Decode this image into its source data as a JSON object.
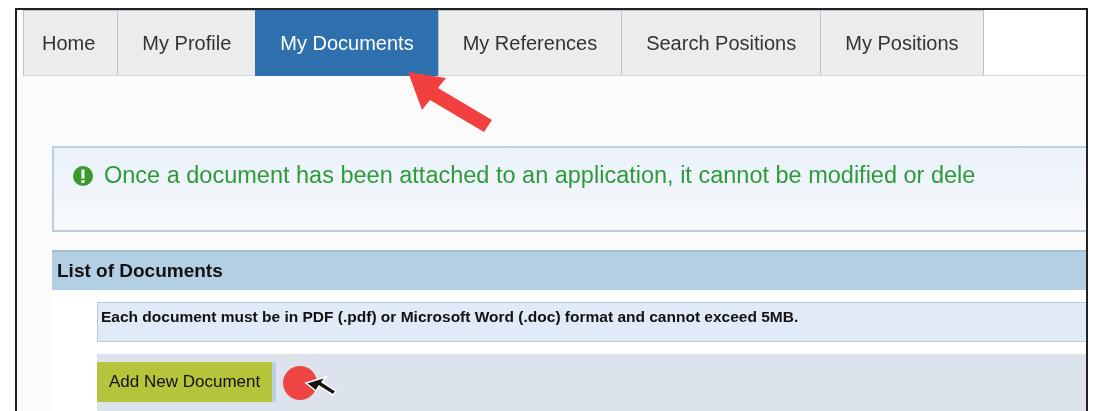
{
  "tabs": [
    {
      "label": "Home",
      "selected": false
    },
    {
      "label": "My Profile",
      "selected": false
    },
    {
      "label": "My Documents",
      "selected": true
    },
    {
      "label": "My References",
      "selected": false
    },
    {
      "label": "Search Positions",
      "selected": false
    },
    {
      "label": "My Positions",
      "selected": false
    }
  ],
  "alert": {
    "message": "Once a document has been attached to an application, it cannot be modified or dele"
  },
  "documents_panel": {
    "title": "List of Documents",
    "note": "Each document must be in PDF (.pdf) or Microsoft Word (.doc) format and cannot exceed 5MB.",
    "add_button": "Add New Document"
  }
}
